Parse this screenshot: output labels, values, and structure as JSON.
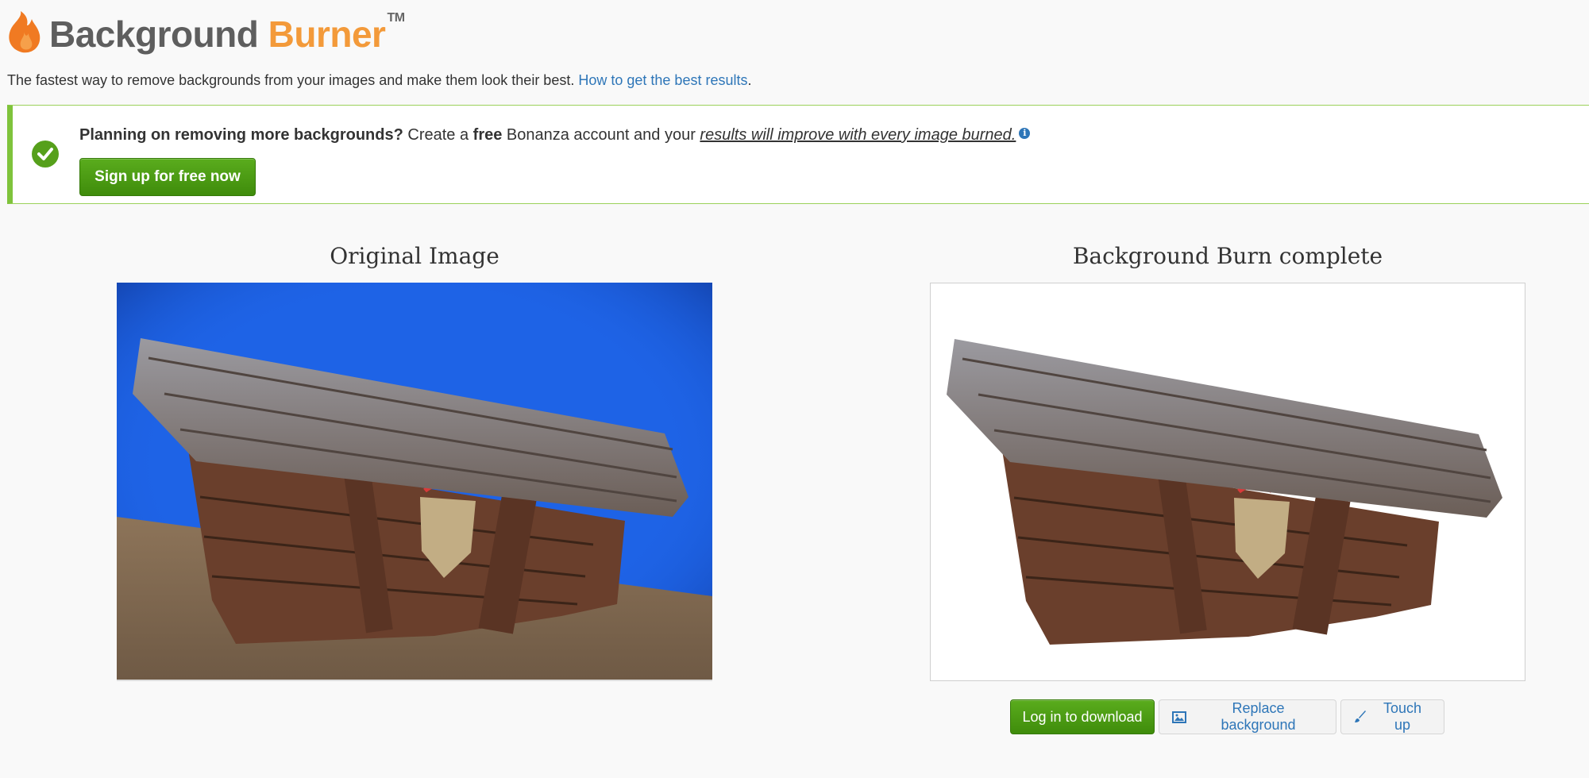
{
  "brand": {
    "name_part1": "Background",
    "name_part2": "Burner",
    "trademark": "TM",
    "colors": {
      "gray": "#5e5e5e",
      "orange": "#f39a3a"
    }
  },
  "tagline": {
    "text": "The fastest way to remove backgrounds from your images and make them look their best.",
    "link": "How to get the best results",
    "suffix": "."
  },
  "banner": {
    "lead_bold": "Planning on removing more backgrounds?",
    "text1": " Create a ",
    "free_bold": "free",
    "text2": " Bonanza account and your ",
    "emphasis": "results will improve with every image burned.",
    "info_icon": "i",
    "signup_label": "Sign up for free now",
    "accent": "#7fc33b"
  },
  "left_column": {
    "title": "Original Image"
  },
  "right_column": {
    "title": "Background Burn complete"
  },
  "actions": {
    "download_label": "Log in to download",
    "replace_label": "Replace background",
    "touchup_label": "Touch up",
    "icons": [
      "image-icon",
      "brush-icon"
    ]
  }
}
